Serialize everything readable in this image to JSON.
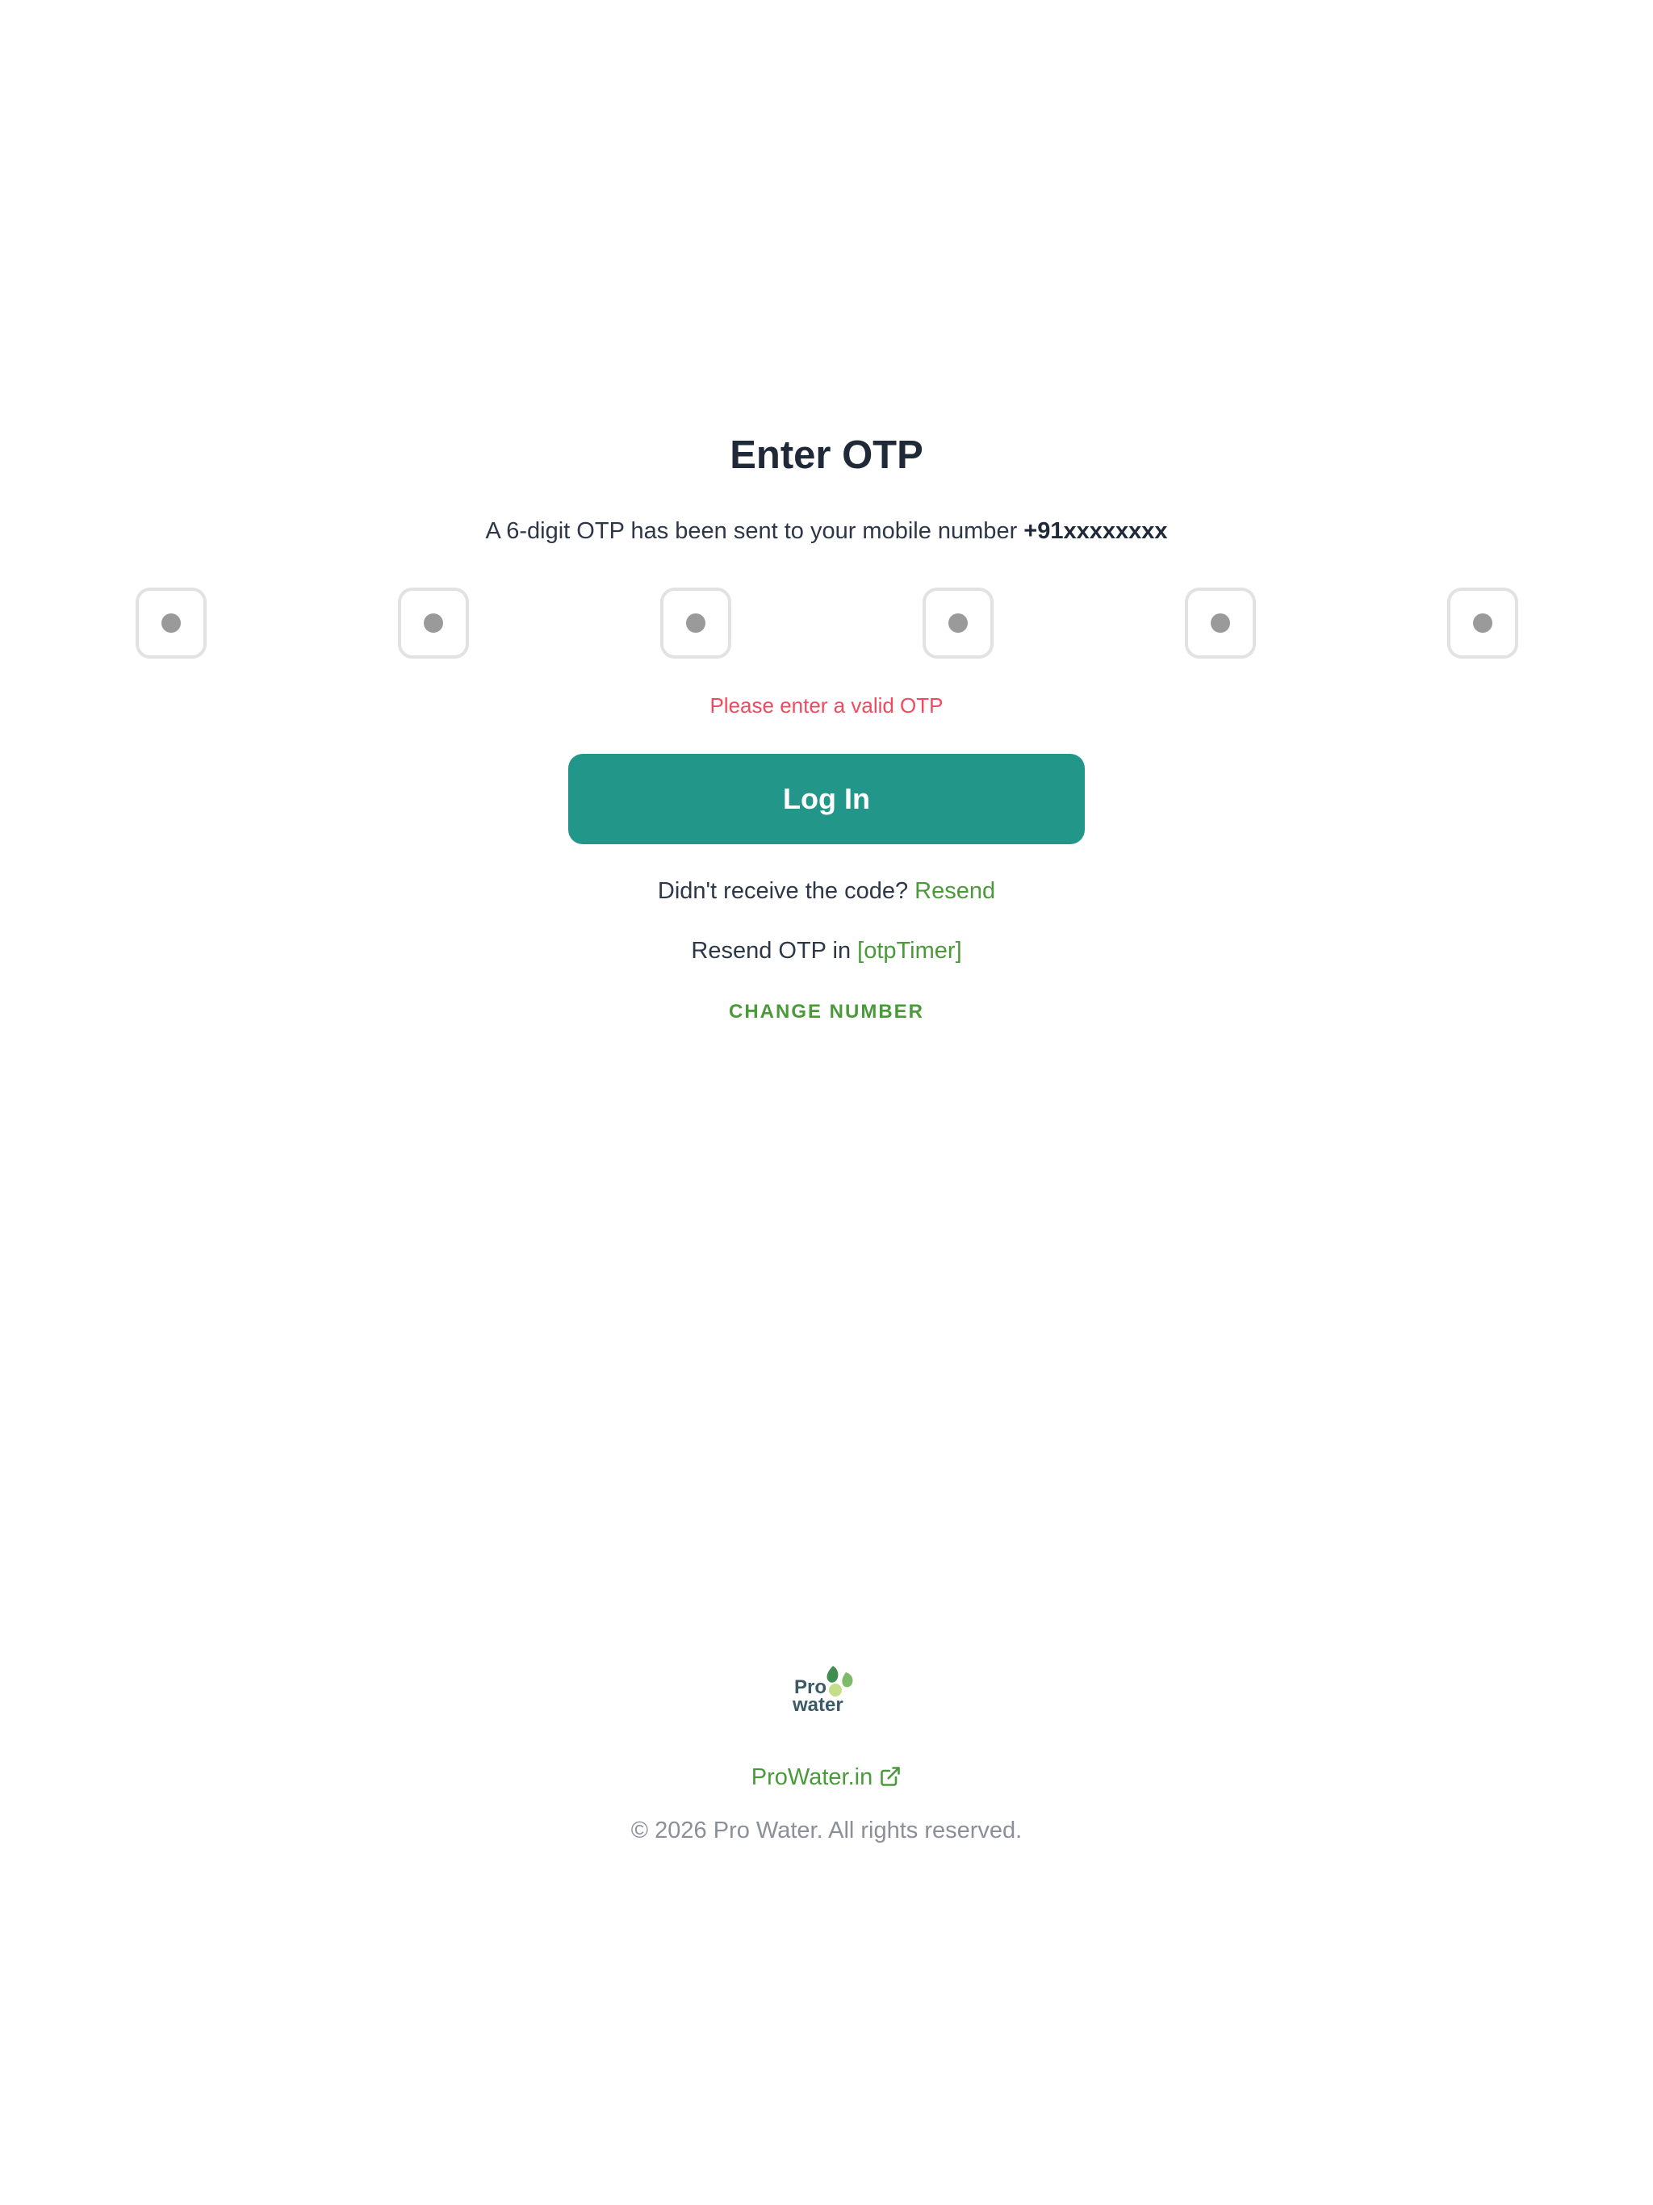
{
  "otp": {
    "title": "Enter OTP",
    "subtitle_prefix": "A 6-digit OTP has been sent to your mobile number ",
    "phone": "+91xxxxxxxx",
    "digit_count": 6,
    "error": "Please enter a valid OTP",
    "login_label": "Log In",
    "resend_prompt": "Didn't receive the code? ",
    "resend_link": "Resend",
    "timer_prefix": "Resend OTP in ",
    "timer_value": "[otpTimer]",
    "change_number": "CHANGE NUMBER"
  },
  "footer": {
    "logo_text_top": "Pro",
    "logo_text_bottom": "water",
    "site_link": "ProWater.in",
    "copyright": "© 2026 Pro Water. All rights reserved."
  },
  "colors": {
    "primary": "#23968a",
    "link": "#4a9a3a",
    "error": "#ef4b5f",
    "text": "#1f2937",
    "muted": "#8a8f98"
  },
  "icons": {
    "external_link": "external-link-icon",
    "otp_dot": "dot"
  }
}
